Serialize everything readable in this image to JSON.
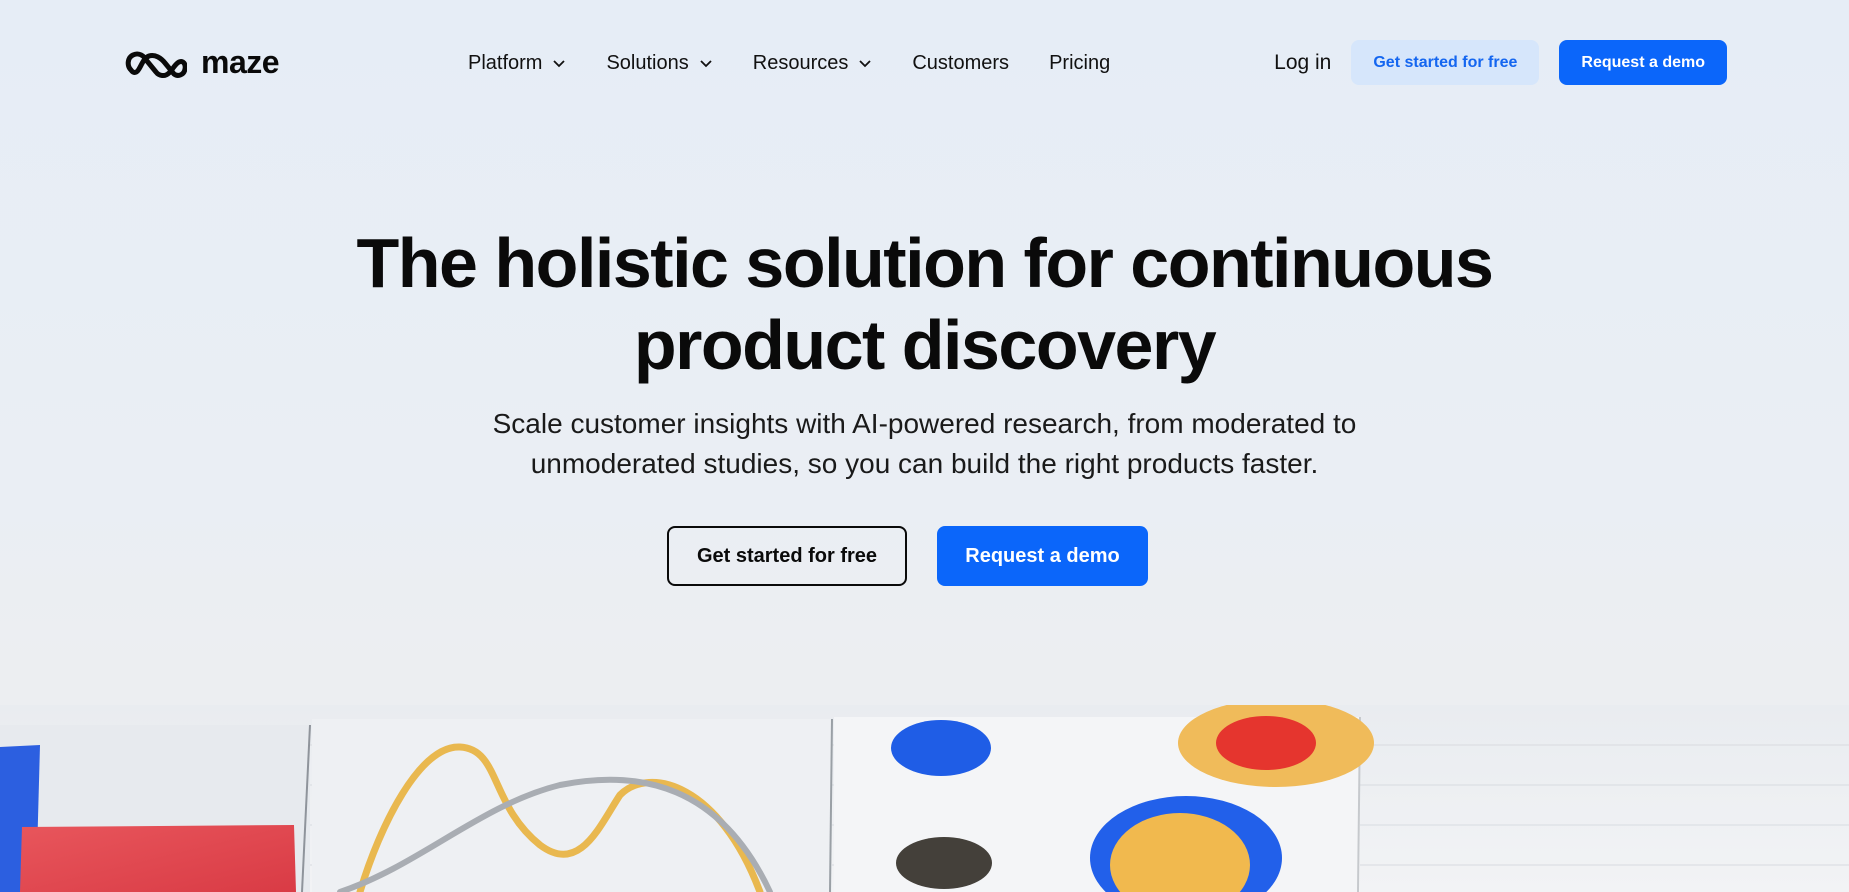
{
  "brand": {
    "name": "maze",
    "logo_icon": "maze-logo-icon"
  },
  "nav": {
    "items": [
      {
        "label": "Platform",
        "has_dropdown": true
      },
      {
        "label": "Solutions",
        "has_dropdown": true
      },
      {
        "label": "Resources",
        "has_dropdown": true
      },
      {
        "label": "Customers",
        "has_dropdown": false
      },
      {
        "label": "Pricing",
        "has_dropdown": false
      }
    ],
    "login_label": "Log in",
    "cta_secondary": "Get started for free",
    "cta_primary": "Request a demo"
  },
  "hero": {
    "title_line1": "The holistic solution for continuous",
    "title_line2": "product discovery",
    "subtitle_line1": "Scale customer insights with AI-powered research, from moderated to",
    "subtitle_line2": "unmoderated studies, so you can build the right products faster.",
    "cta_secondary": "Get started for free",
    "cta_primary": "Request a demo"
  },
  "colors": {
    "accent": "#0b66fa",
    "accent_light": "#d6e6fb",
    "background": "#e8eef6",
    "text": "#0a0a0a"
  }
}
